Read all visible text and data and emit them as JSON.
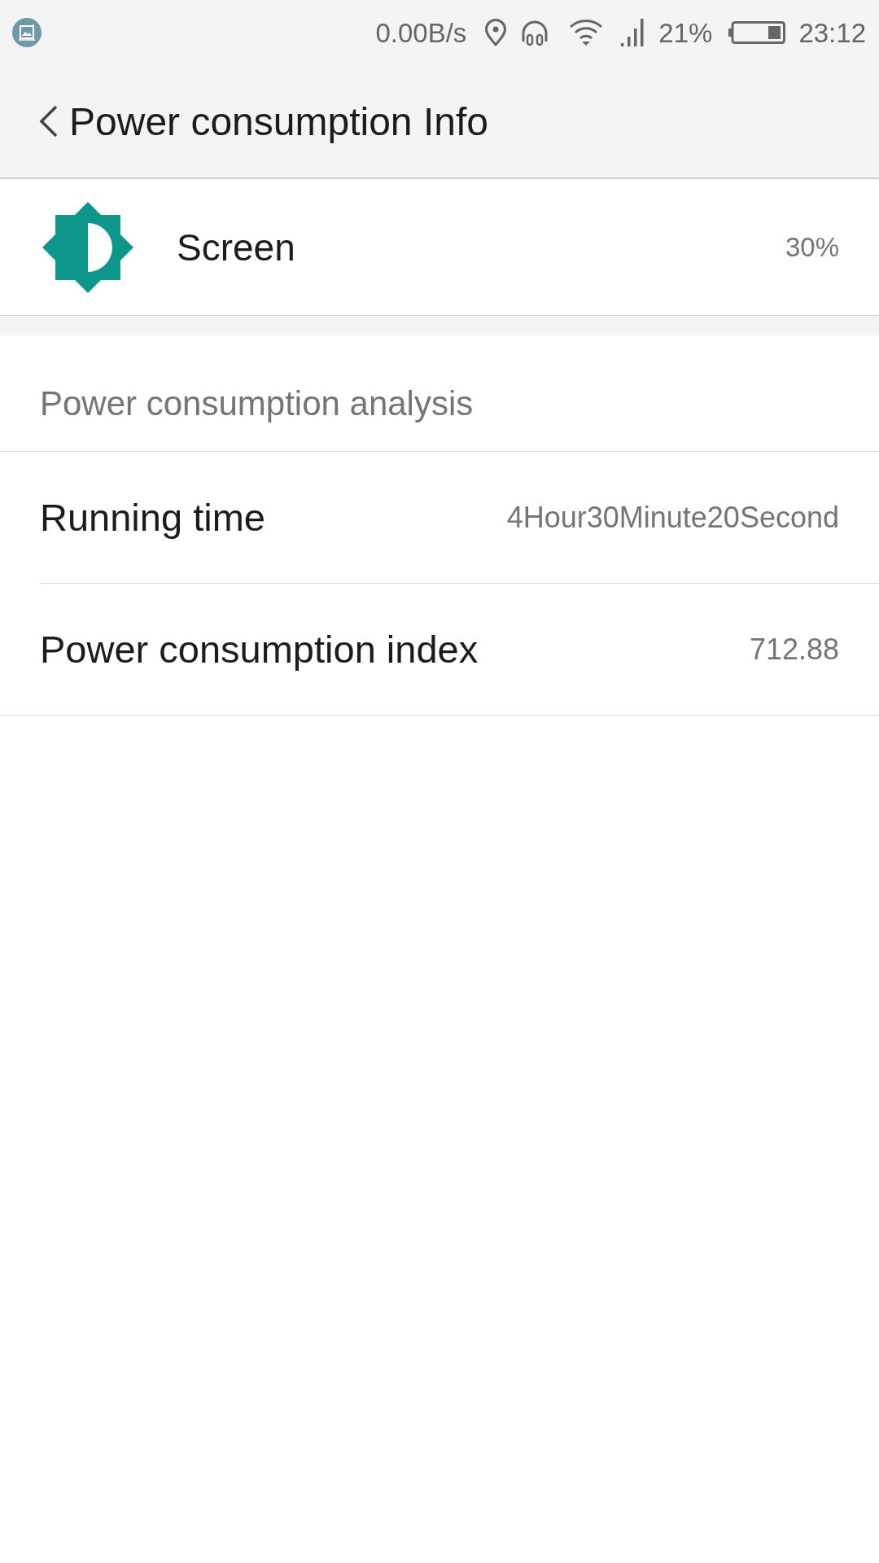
{
  "status_bar": {
    "network_speed": "0.00B/s",
    "battery_percent": "21%",
    "time": "23:12"
  },
  "header": {
    "title": "Power consumption Info"
  },
  "usage_item": {
    "name": "Screen",
    "percent": "30%"
  },
  "analysis": {
    "heading": "Power consumption analysis",
    "rows": [
      {
        "label": "Running time",
        "value": "4Hour30Minute20Second"
      },
      {
        "label": "Power consumption index",
        "value": "712.88"
      }
    ]
  }
}
